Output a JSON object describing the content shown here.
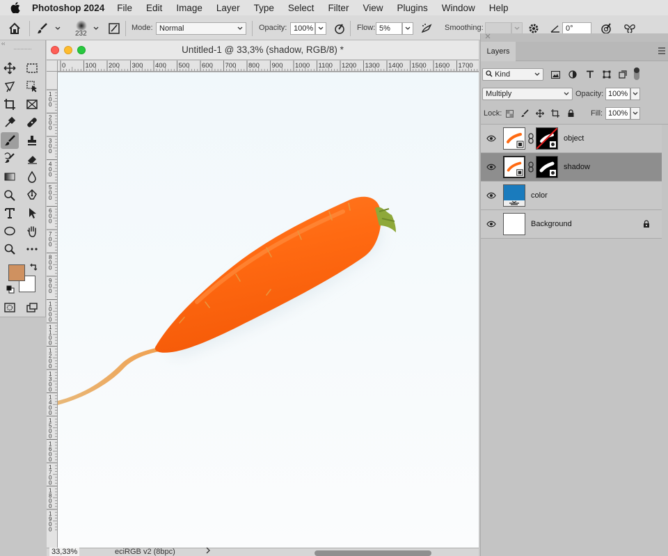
{
  "menubar": {
    "app_name": "Photoshop 2024",
    "menus": [
      "File",
      "Edit",
      "Image",
      "Layer",
      "Type",
      "Select",
      "Filter",
      "View",
      "Plugins",
      "Window",
      "Help"
    ]
  },
  "options": {
    "brush_size": "232",
    "mode_label": "Mode:",
    "mode_value": "Normal",
    "opacity_label": "Opacity:",
    "opacity_value": "100%",
    "flow_label": "Flow:",
    "flow_value": "5%",
    "smoothing_label": "Smoothing:",
    "smoothing_value": "",
    "angle_value": "0°"
  },
  "toolbar": {
    "foreground_color": "#cf9160",
    "background_color": "#ffffff"
  },
  "document": {
    "title": "Untitled-1 @ 33,3% (shadow, RGB/8) *",
    "ruler_top_labels": [
      "0",
      "100",
      "200",
      "300",
      "400",
      "500",
      "600",
      "700",
      "800",
      "900",
      "1000",
      "1100",
      "1200",
      "1300",
      "1400",
      "1500",
      "1600",
      "1700"
    ],
    "ruler_left_labels": [
      "1\n0\n0",
      "2\n0\n0",
      "3\n0\n0",
      "4\n0\n0",
      "5\n0\n0",
      "6\n0\n0",
      "7\n0\n0",
      "8\n0\n0",
      "9\n0\n0",
      "1\n0\n0\n0",
      "1\n1\n0\n0",
      "1\n2\n0\n0",
      "1\n3\n0\n0",
      "1\n4\n0\n0",
      "1\n5\n0\n0",
      "1\n6\n0\n0",
      "1\n7\n0\n0",
      "1\n8\n0\n0",
      "1\n9\n0\n0"
    ],
    "zoom": "33,33%",
    "profile": "eciRGB v2 (8bpc)"
  },
  "layers_panel": {
    "tab_label": "Layers",
    "filter_kind": "Kind",
    "blend_mode": "Multiply",
    "opacity_label": "Opacity:",
    "opacity_value": "100%",
    "lock_label": "Lock:",
    "fill_label": "Fill:",
    "fill_value": "100%",
    "layers": [
      {
        "name": "object",
        "selected": false
      },
      {
        "name": "shadow",
        "selected": true
      },
      {
        "name": "color",
        "selected": false,
        "swatch": "#1a7bbd"
      },
      {
        "name": "Background",
        "selected": false,
        "locked": true
      }
    ]
  }
}
